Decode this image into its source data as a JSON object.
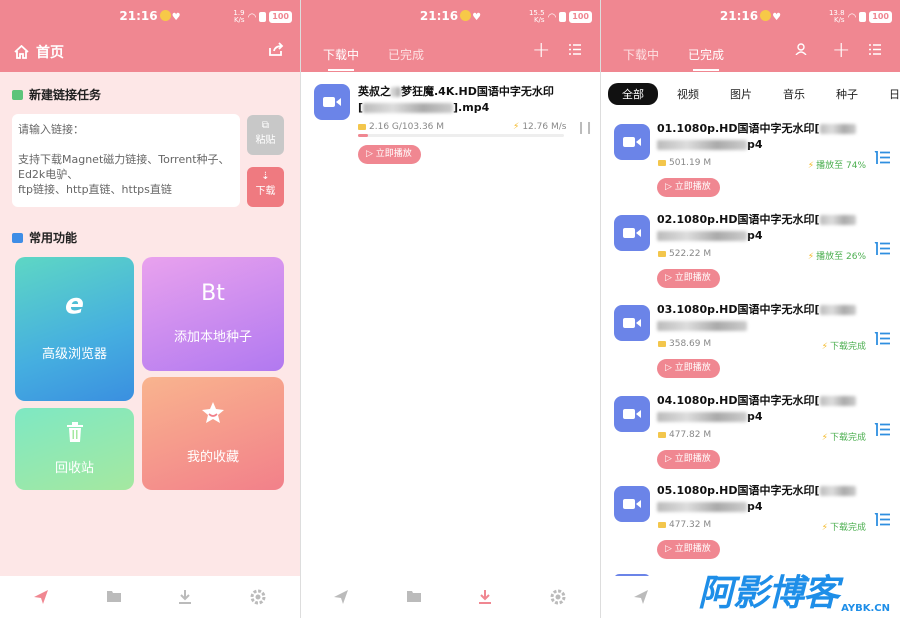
{
  "status": {
    "time": "21:16",
    "battery": "100",
    "net1": "1.9\nK/s",
    "net2": "15.5\nK/s",
    "net3": "13.8\nK/s"
  },
  "panel1": {
    "title": "首页",
    "new_task": "新建链接任务",
    "placeholder": "请输入链接：",
    "hint1": "支持下载Magnet磁力链接、Torrent种子、",
    "hint2": "Ed2k电驴、",
    "hint3": "ftp链接、http直链、https直链",
    "paste": "粘贴",
    "download": "下载",
    "common": "常用功能",
    "browser": "高级浏览器",
    "bt_icon": "Bt",
    "add_torrent": "添加本地种子",
    "recycle": "回收站",
    "favorites": "我的收藏"
  },
  "panel2": {
    "tab_downloading": "下载中",
    "tab_done": "已完成",
    "file_line1": "英叔之",
    "file_line1b": "梦狂魔.4K.HD国语中字无水印",
    "file_line2a": "[",
    "file_line2b": "].mp4",
    "size": "2.16 G/103.36 M",
    "speed": "12.76 M/s",
    "progress": 0.05,
    "play": "立即播放"
  },
  "panel3": {
    "tab_downloading": "下载中",
    "tab_done": "已完成",
    "filters": [
      "全部",
      "视频",
      "图片",
      "音乐",
      "种子",
      "日"
    ],
    "play": "立即播放",
    "items": [
      {
        "title": "01.1080p.HD国语中字无水印[",
        "ext": "p4",
        "size": "501.19 M",
        "status": "播放至 74%",
        "color": "#4caf50"
      },
      {
        "title": "02.1080p.HD国语中字无水印[",
        "ext": "p4",
        "size": "522.22 M",
        "status": "播放至 26%",
        "color": "#4caf50"
      },
      {
        "title": "03.1080p.HD国语中字无水印[",
        "ext": "",
        "size": "358.69 M",
        "status": "下载完成",
        "color": "#4caf50"
      },
      {
        "title": "04.1080p.HD国语中字无水印[",
        "ext": "p4",
        "size": "477.82 M",
        "status": "下载完成",
        "color": "#4caf50"
      },
      {
        "title": "05.1080p.HD国语中字无水印[",
        "ext": "p4",
        "size": "477.32 M",
        "status": "下载完成",
        "color": "#4caf50"
      }
    ]
  },
  "watermark": {
    "cn": "阿影博客",
    "en": "AYBK.CN"
  },
  "colors": {
    "accent": "#f08791",
    "video": "#6b84e8",
    "menu": "#2f8fe0"
  }
}
